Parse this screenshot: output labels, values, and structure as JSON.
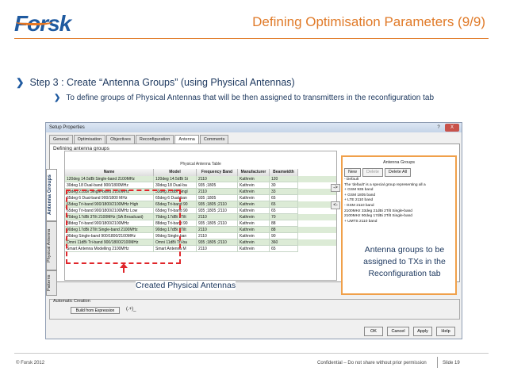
{
  "slide": {
    "logo": "Forsk",
    "title": "Defining Optimisation Parameters (9/9)",
    "bullet1": "Step 3 : Create “Antenna Groups” (using Physical Antennas)",
    "bullet2": "To define groups of Physical Antennas that will be then assigned to transmitters in the reconfiguration tab"
  },
  "window": {
    "title": "Setup Properties",
    "help": "?",
    "close": "X",
    "tabs": [
      "General",
      "Optimisation",
      "Objectives",
      "Reconfiguration",
      "Antenna",
      "Comments"
    ],
    "panel_title": "Defining antenna groups",
    "vertical_tabs": [
      "Antenna Groups",
      "Physical Antenna",
      "Patterns"
    ],
    "grid": {
      "caption": "Physical Antenna Table",
      "columns": [
        "Name",
        "Model",
        "Frequency Band",
        "Manufacturer",
        "Beamwidth"
      ],
      "rows": [
        [
          "120deg 14.5dBi Single-band 2100MHz",
          "120deg 14.5dBi Si",
          "2110",
          "Kathrein",
          "120"
        ],
        [
          "30deg 18 Dual-band 900/1800MHz",
          "30deg 18 Dual-ba",
          "935 ;1805",
          "Kathrein",
          "30"
        ],
        [
          "33deg 21dBi Single-band 2100MHz",
          "33deg 21dBi Singl",
          "2110",
          "Kathrein",
          "33"
        ],
        [
          "65deg 6 Dual-band 900/1800 MHz",
          "65deg 6 Dual-ban",
          "935 ;1805",
          "Kathrein",
          "65"
        ],
        [
          "65deg Tri-band 900/1800/2100MHz High",
          "65deg Tri-band 90",
          "935 ;1805 ;2110",
          "Kathrein",
          "65"
        ],
        [
          "65deg Tri-band 900/1800/2100MHz Low",
          "65deg Tri-band 90",
          "935 ;1805 ;2110",
          "Kathrein",
          "65"
        ],
        [
          "70deg 17dBi 3Tilt 2100MHz (SA Broadcast)",
          "70deg 17dBi 3Tilt",
          "2110",
          "Kathrein",
          "70"
        ],
        [
          "88deg Tri-band 900/1800/2100MHz",
          "88deg Tri-band 90",
          "935 ;1805 ;2110",
          "Kathrein",
          "88"
        ],
        [
          "90deg 17dBi 2Tilt Single-band 2100MHz",
          "90deg 17dBi 2Tilt",
          "2110",
          "Kathrein",
          "88"
        ],
        [
          "90deg Single-band 900/1800/2100MHz",
          "90deg Single-ban",
          "2110",
          "Kathrein",
          "90"
        ],
        [
          "Omni 11dBi Tri-band 900/1800/2100MHz",
          "Omni 11dBi Tri-ba",
          "935 ;1805 ;2110",
          "Kathrein",
          "360"
        ],
        [
          "Smart Antenna Modelling 2100MHz",
          "Smart Antenna M",
          "2110",
          "Kathrein",
          "65"
        ]
      ]
    },
    "move_right": "->",
    "move_left": "<-",
    "groups": {
      "title": "Antenna Groups",
      "buttons": [
        "New",
        "Delete",
        "Delete All"
      ],
      "tree": [
        "- Default",
        "    The 'default' is a special group representing all a",
        "+ GSM 935 band",
        "+ GSM 1805 band",
        "+ LTE 2110 band",
        "- GSM 2110 band",
        "    2100MHz 33deg 21dBi 2Tilt Single-band",
        "    2100MHz 90deg 17dBi 2Tilt Single-band",
        "+ UMTS 2110 band"
      ]
    },
    "auto_creation": {
      "title": "Automatic Creation",
      "button": "Build from Expression",
      "expression": "(.+)_"
    },
    "bottom_buttons": [
      "OK",
      "Cancel",
      "Apply",
      "Help"
    ]
  },
  "annotations": {
    "created": "Created Physical Antennas",
    "groups_note": "Antenna groups to be assigned to TXs in the Reconfiguration tab"
  },
  "footer": {
    "left": "© Forsk 2012",
    "confidential": "Confidential – Do not share without prior permission",
    "slide": "Slide 19"
  },
  "colors": {
    "accent": "#e07a28",
    "brand": "#1f5aa0",
    "highlight_red": "#e0262b",
    "group_border": "#f0a04a"
  }
}
